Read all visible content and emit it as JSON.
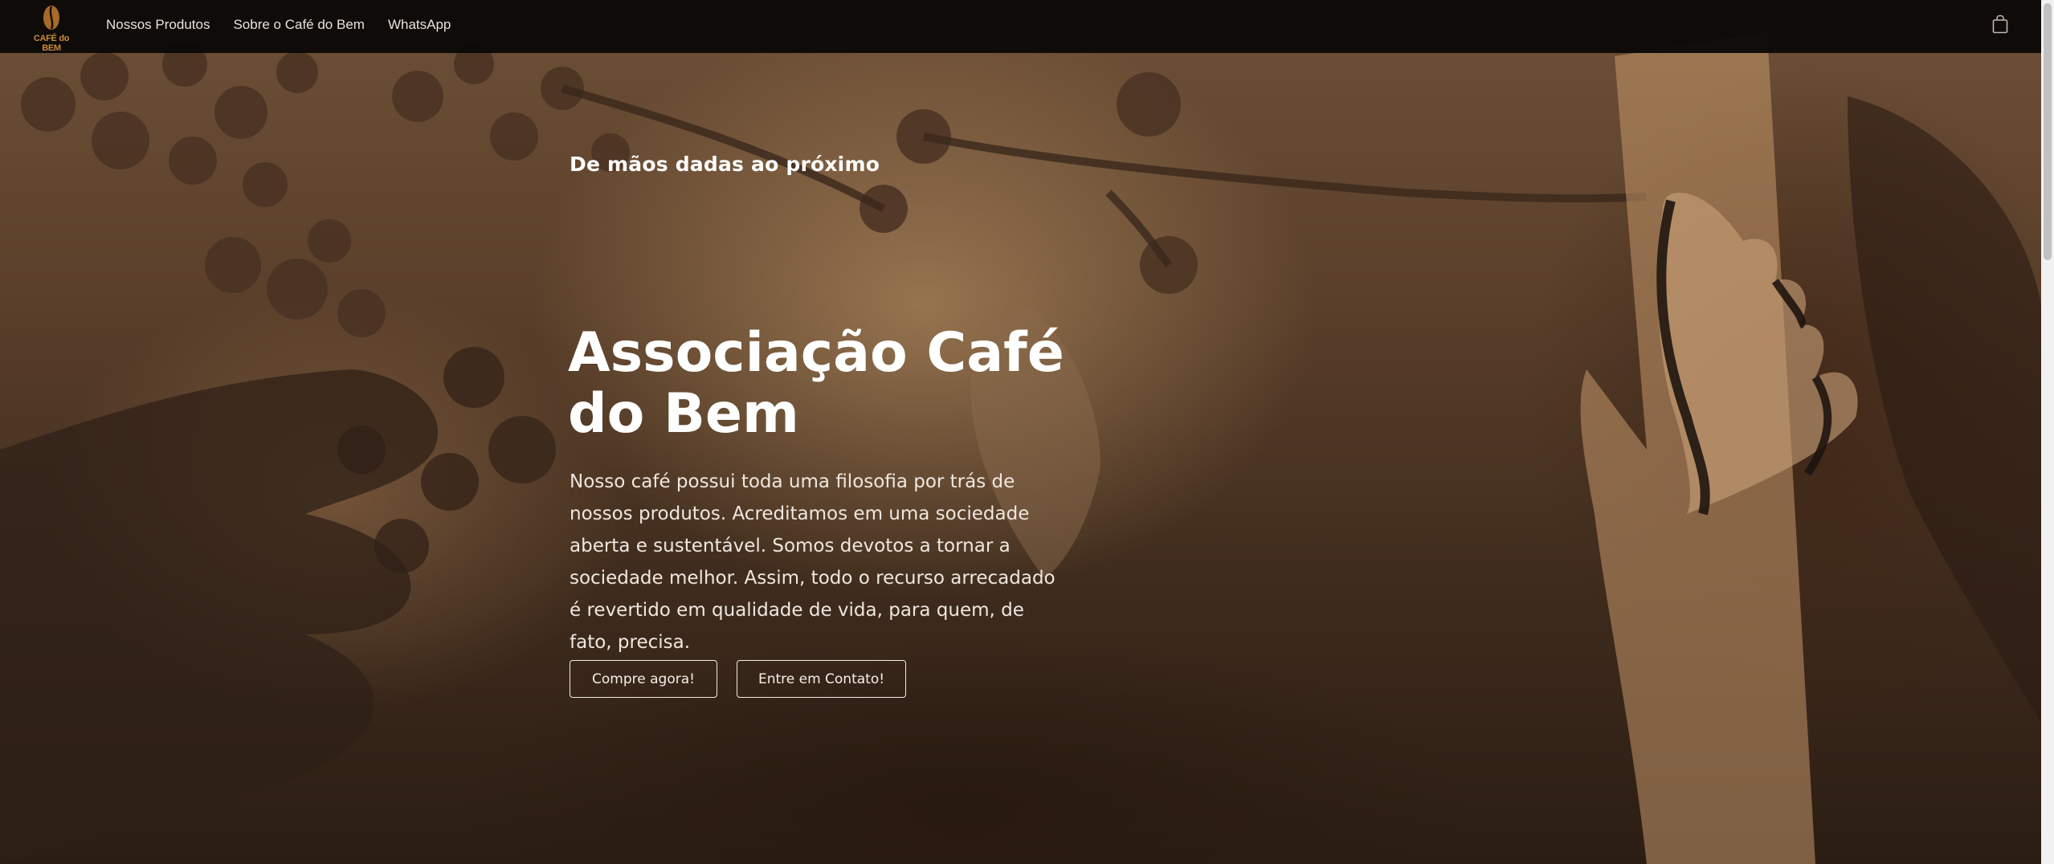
{
  "header": {
    "logo_text": "CAFÉ do BEM",
    "nav": [
      {
        "label": "Nossos Produtos"
      },
      {
        "label": "Sobre o Café do Bem"
      },
      {
        "label": "WhatsApp"
      }
    ],
    "cart_icon": "shopping-bag-icon"
  },
  "hero": {
    "kicker": "De mãos dadas ao próximo",
    "title": "Associação Café do Bem",
    "description": "Nosso café possui toda uma filosofia por trás de nossos produtos. Acreditamos em uma sociedade aberta e sustentável. Somos devotos a tornar a sociedade melhor. Assim, todo o recurso arrecadado é revertido em qualidade de vida, para quem, de fato, precisa.",
    "buttons": {
      "buy": "Compre agora!",
      "contact": "Entre em Contato!"
    }
  },
  "colors": {
    "header_bg": "#080605",
    "hero_tint": "#6e5037",
    "logo_accent": "#c98a3b",
    "text": "#ffffff"
  }
}
